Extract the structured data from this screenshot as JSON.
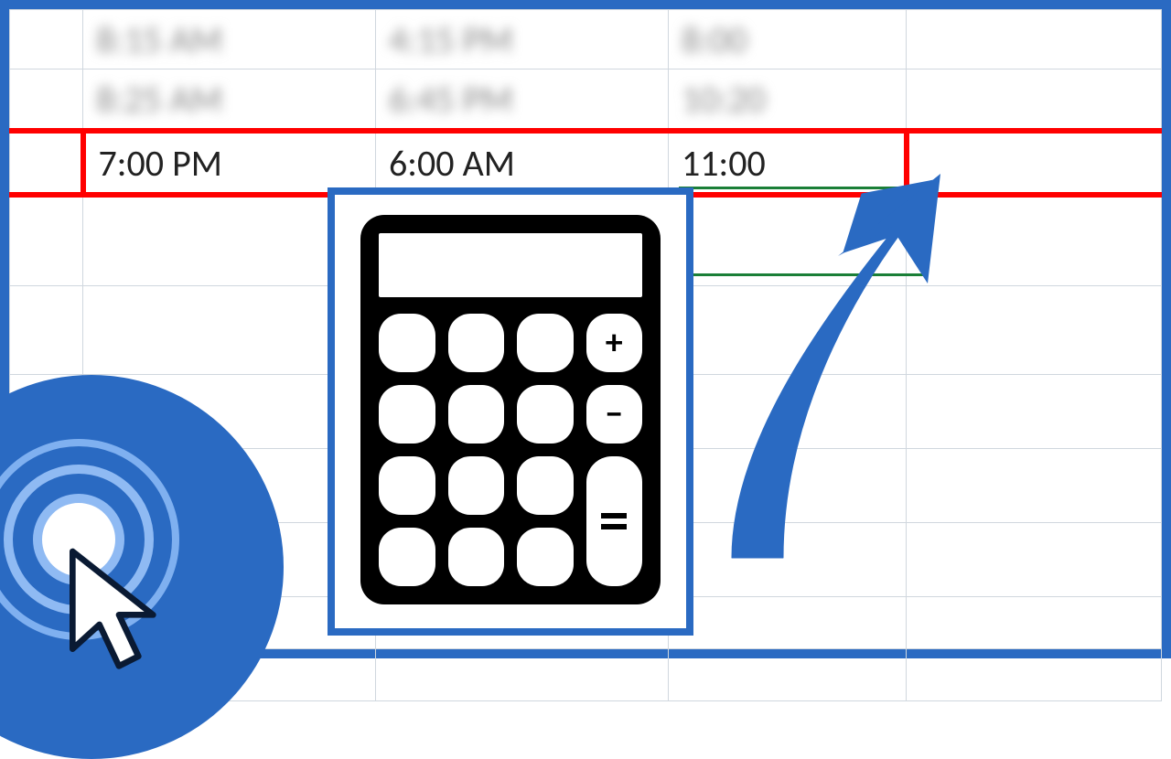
{
  "colors": {
    "frame": "#2a6ac2",
    "highlight": "#ff0000",
    "active_cell_border": "#1a7f37",
    "arrow": "#2a6ac2"
  },
  "spreadsheet": {
    "blurred_rows": [
      {
        "start": "8:15 AM",
        "end": "4:15 PM",
        "duration": "8:00"
      },
      {
        "start": "8:25 AM",
        "end": "6:45 PM",
        "duration": "10:20"
      }
    ],
    "highlighted_row": {
      "start": "7:00 PM",
      "end": "6:00 AM",
      "duration": "11:00"
    }
  },
  "overlays": {
    "calculator_icon": "calculator-icon",
    "arrow_icon": "curved-arrow-icon",
    "logo_icon": "click-cursor-logo-icon"
  }
}
